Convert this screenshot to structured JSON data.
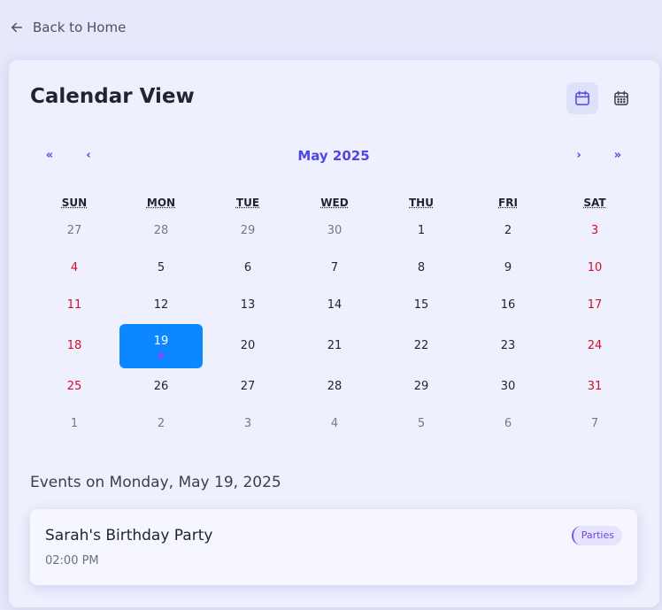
{
  "back_link": {
    "label": "Back to Home",
    "icon": "arrow-left-icon"
  },
  "header": {
    "title": "Calendar View",
    "view_buttons": [
      {
        "icon": "calendar-icon",
        "active": true
      },
      {
        "icon": "calendar-grid-icon",
        "active": false
      }
    ]
  },
  "navigation": {
    "prev_year": "«",
    "prev_month": "‹",
    "month_label": "May 2025",
    "next_month": "›",
    "next_year": "»"
  },
  "weekdays": [
    "SUN",
    "MON",
    "TUE",
    "WED",
    "THU",
    "FRI",
    "SAT"
  ],
  "weeks": [
    [
      {
        "d": "27",
        "other": true
      },
      {
        "d": "28",
        "other": true
      },
      {
        "d": "29",
        "other": true
      },
      {
        "d": "30",
        "other": true
      },
      {
        "d": "1"
      },
      {
        "d": "2"
      },
      {
        "d": "3"
      }
    ],
    [
      {
        "d": "4"
      },
      {
        "d": "5"
      },
      {
        "d": "6"
      },
      {
        "d": "7"
      },
      {
        "d": "8"
      },
      {
        "d": "9"
      },
      {
        "d": "10"
      }
    ],
    [
      {
        "d": "11"
      },
      {
        "d": "12"
      },
      {
        "d": "13"
      },
      {
        "d": "14"
      },
      {
        "d": "15"
      },
      {
        "d": "16"
      },
      {
        "d": "17"
      }
    ],
    [
      {
        "d": "18"
      },
      {
        "d": "19",
        "selected": true,
        "has_event": true
      },
      {
        "d": "20"
      },
      {
        "d": "21"
      },
      {
        "d": "22"
      },
      {
        "d": "23"
      },
      {
        "d": "24"
      }
    ],
    [
      {
        "d": "25"
      },
      {
        "d": "26"
      },
      {
        "d": "27"
      },
      {
        "d": "28"
      },
      {
        "d": "29"
      },
      {
        "d": "30"
      },
      {
        "d": "31"
      }
    ],
    [
      {
        "d": "1",
        "other": true
      },
      {
        "d": "2",
        "other": true
      },
      {
        "d": "3",
        "other": true
      },
      {
        "d": "4",
        "other": true
      },
      {
        "d": "5",
        "other": true
      },
      {
        "d": "6",
        "other": true
      },
      {
        "d": "7",
        "other": true
      }
    ]
  ],
  "events_section": {
    "heading": "Events on Monday, May 19, 2025",
    "events": [
      {
        "title": "Sarah's Birthday Party",
        "time": "02:00 PM",
        "category": "Parties"
      }
    ]
  },
  "colors": {
    "accent": "#4f46e5",
    "selected_day": "#0d87ff",
    "weekend": "#d0102c",
    "event_dot": "#7c4dff",
    "badge_bg": "#e7e2fd"
  }
}
